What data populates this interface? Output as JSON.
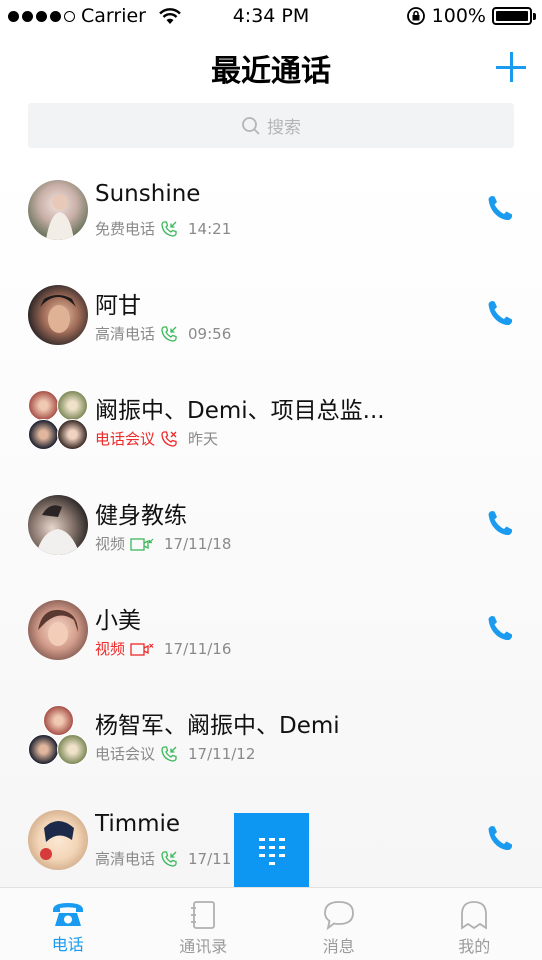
{
  "status_bar": {
    "carrier": "Carrier",
    "time": "4:34 PM",
    "battery": "100%"
  },
  "header": {
    "title": "最近通话"
  },
  "search": {
    "placeholder": "搜索"
  },
  "calls": [
    {
      "name": "Sunshine",
      "type": "免费电话",
      "type_color": "gray",
      "icon": "phone-incoming-icon",
      "icon_color": "#3cb85c",
      "time": "14:21",
      "has_call_button": true
    },
    {
      "name": "阿甘",
      "type": "高清电话",
      "type_color": "gray",
      "icon": "phone-incoming-icon",
      "icon_color": "#3cb85c",
      "time": "09:56",
      "has_call_button": true
    },
    {
      "name": "阚振中、Demi、项目总监...",
      "type": "电话会议",
      "type_color": "red",
      "icon": "phone-missed-icon",
      "icon_color": "#ee2a2a",
      "time": "昨天",
      "has_call_button": false
    },
    {
      "name": "健身教练",
      "type": "视频",
      "type_color": "gray",
      "icon": "video-incoming-icon",
      "icon_color": "#3cb85c",
      "time": "17/11/18",
      "has_call_button": true
    },
    {
      "name": "小美",
      "type": "视频",
      "type_color": "red",
      "icon": "video-missed-icon",
      "icon_color": "#ee2a2a",
      "time": "17/11/16",
      "has_call_button": true
    },
    {
      "name": "杨智军、阚振中、Demi",
      "type": "电话会议",
      "type_color": "gray",
      "icon": "phone-incoming-icon",
      "icon_color": "#3cb85c",
      "time": "17/11/12",
      "has_call_button": false
    },
    {
      "name": "Timmie",
      "type": "高清电话",
      "type_color": "gray",
      "icon": "phone-incoming-icon",
      "icon_color": "#3cb85c",
      "time": "17/11",
      "has_call_button": true
    }
  ],
  "tabs": [
    {
      "label": "电话",
      "icon": "phone-tab-icon",
      "active": true
    },
    {
      "label": "通讯录",
      "icon": "contacts-icon",
      "active": false
    },
    {
      "label": "消息",
      "icon": "message-icon",
      "active": false
    },
    {
      "label": "我的",
      "icon": "profile-icon",
      "active": false
    }
  ],
  "colors": {
    "accent": "#1a9bf0",
    "missed": "#ee2a2a",
    "incoming": "#3cb85c"
  }
}
